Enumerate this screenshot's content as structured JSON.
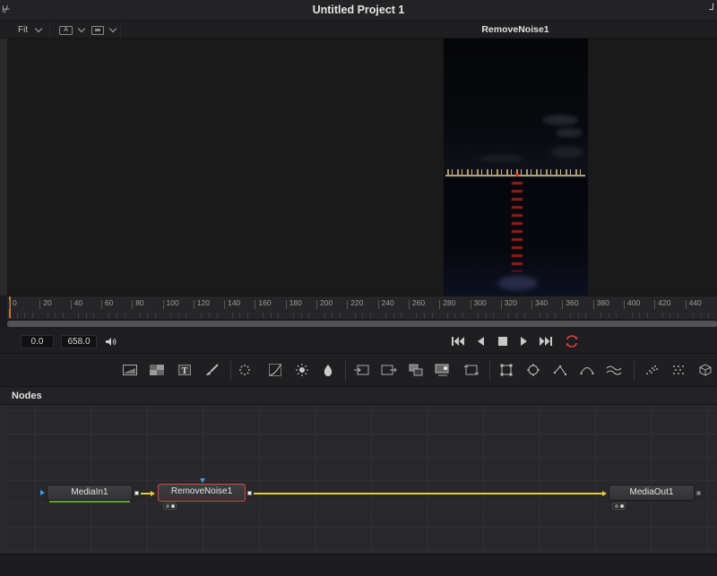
{
  "window": {
    "title": "Untitled Project 1",
    "left_glyph": "⊬",
    "right_glyph": "⅃"
  },
  "viewer": {
    "zoom_label": "Fit",
    "channel_icon": "A",
    "clip_name": "RemoveNoise1"
  },
  "ruler": {
    "ticks": [
      "0",
      "20",
      "40",
      "60",
      "80",
      "100",
      "120",
      "140",
      "160",
      "180",
      "200",
      "220",
      "240",
      "260",
      "280",
      "300",
      "320",
      "340",
      "360",
      "380",
      "400",
      "420",
      "440"
    ]
  },
  "transport": {
    "current_time": "0.0",
    "end_time": "658.0",
    "buttons": [
      "go-to-start",
      "step-back",
      "stop",
      "play",
      "go-to-end",
      "loop"
    ]
  },
  "toolbar": {
    "tools": [
      "background-icon",
      "fast-noise-icon",
      "text-icon",
      "paint-icon",
      "particles-icon",
      "curves-icon",
      "brightness-contrast-icon",
      "color-corrector-icon",
      "loader-icon",
      "saver-icon",
      "merge-icon",
      "media-out-icon",
      "transform-icon",
      "rectangle-mask-icon",
      "ellipse-mask-icon",
      "polygon-mask-icon",
      "bspline-mask-icon",
      "warp-icon",
      "pemitter-icon",
      "prender-icon",
      "shape3d-icon"
    ]
  },
  "nodes": {
    "panel_title": "Nodes",
    "items": [
      {
        "name": "MediaIn1"
      },
      {
        "name": "RemoveNoise1"
      },
      {
        "name": "MediaOut1"
      }
    ],
    "link_color": "#e9c93c",
    "selected_border_color": "#d6453e"
  }
}
